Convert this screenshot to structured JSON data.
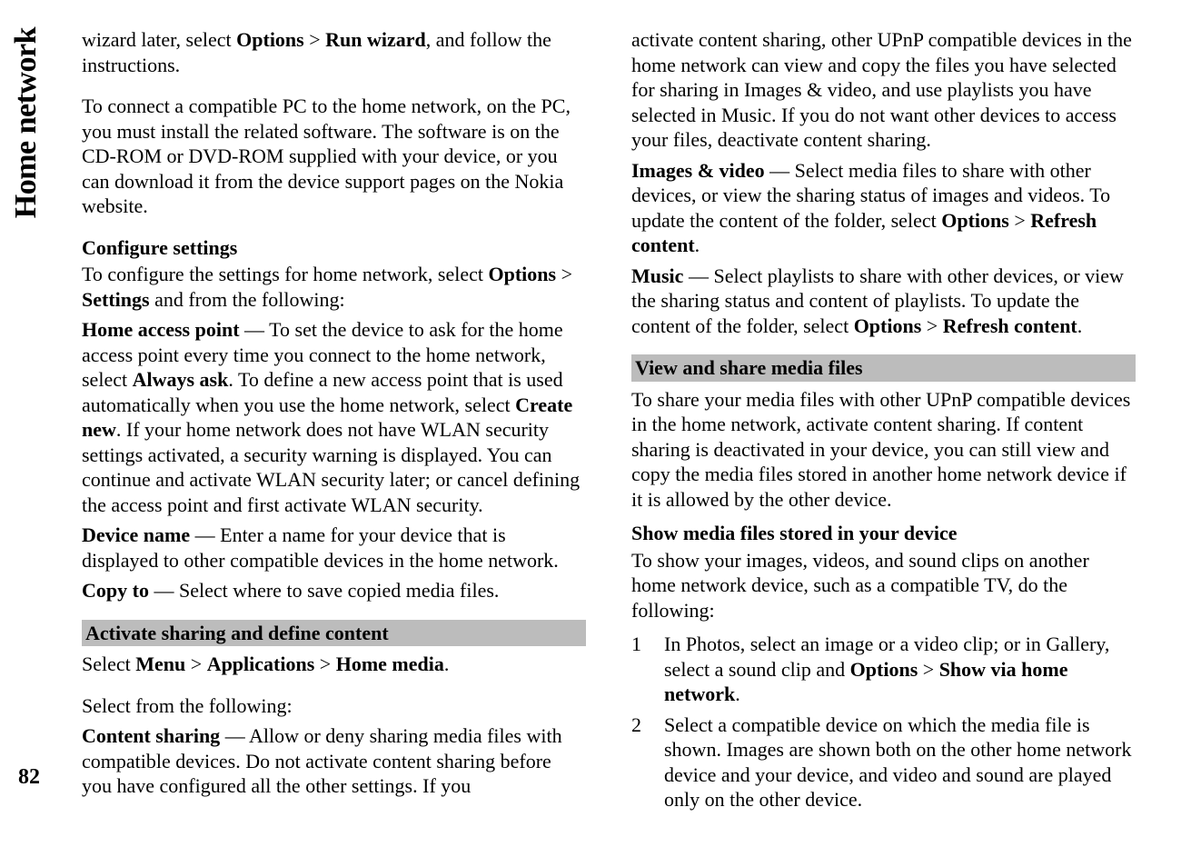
{
  "sideLabel": "Home network",
  "pageNumber": "82",
  "left": {
    "intro1a": "wizard later, select ",
    "intro1b": "Options",
    "intro1c": " > ",
    "intro1d": "Run wizard",
    "intro1e": ", and follow the instructions.",
    "intro2": "To connect a compatible PC to the home network, on the PC, you must install the related software. The software is on the CD-ROM or DVD-ROM supplied with your device, or you can download it from the device support pages on the Nokia website.",
    "confHeading": "Configure settings",
    "conf1a": "To configure the settings for home network, select ",
    "conf1b": "Options",
    "conf1c": " > ",
    "conf1d": "Settings",
    "conf1e": " and from the following:",
    "hapLabel": "Home access point",
    "hap1": "  — To set the device to ask for the home access point every time you connect to the home network, select ",
    "hap2": "Always ask",
    "hap3": ". To define a new access point that is used automatically when you use the home network, select ",
    "hap4": "Create new",
    "hap5": ". If your home network does not have WLAN security settings activated, a security warning is displayed. You can continue and activate WLAN security later; or cancel defining the access point and first activate WLAN security.",
    "devLabel": "Device name",
    "dev1": "  — Enter a name for your device that is displayed to other compatible devices in the home network.",
    "copyLabel": "Copy to",
    "copy1": "  — Select where to save copied media files.",
    "activateHeading": "Activate sharing and define content",
    "act1a": "Select ",
    "act1b": "Menu",
    "act1c": " > ",
    "act1d": "Applications",
    "act1e": " > ",
    "act1f": "Home media",
    "act1g": ".",
    "act2": "Select from the following:",
    "csLabel": "Content sharing",
    "cs1": "  — Allow or deny sharing media files with compatible devices. Do not activate content sharing before you have configured all the other settings. If you"
  },
  "right": {
    "csCont": "activate content sharing, other UPnP compatible devices in the home network can view and copy the files you have selected for sharing in Images & video, and use playlists you have selected in Music. If you do not want other devices to access your files, deactivate content sharing.",
    "ivLabel": "Images & video",
    "iv1": "  — Select media files to share with other devices, or view the sharing status of images and videos. To update the content of the folder, select ",
    "iv2": "Options",
    "iv3": " > ",
    "iv4": "Refresh content",
    "iv5": ".",
    "muLabel": "Music",
    "mu1": "  — Select playlists to share with other devices, or view the sharing status and content of playlists. To update the content of the folder, select ",
    "mu2": "Options",
    "mu3": " > ",
    "mu4": "Refresh content",
    "mu5": ".",
    "viewHeading": "View and share media files",
    "view1": "To share your media files with other UPnP compatible devices in the home network, activate content sharing. If content sharing is deactivated in your device, you can still view and copy the media files stored in another home network device if it is allowed by the other device.",
    "showHeading": "Show media files stored in your device",
    "show1": "To show your images, videos, and sound clips on another home network device, such as a compatible TV, do the following:",
    "li1num": "1",
    "li1a": "In Photos, select an image or a video clip; or in Gallery, select a sound clip and ",
    "li1b": "Options",
    "li1c": " > ",
    "li1d": "Show via home network",
    "li1e": ".",
    "li2num": "2",
    "li2": "Select a compatible device on which the media file is shown. Images are shown both on the other home network device and your device, and video and sound are played only on the other device."
  }
}
